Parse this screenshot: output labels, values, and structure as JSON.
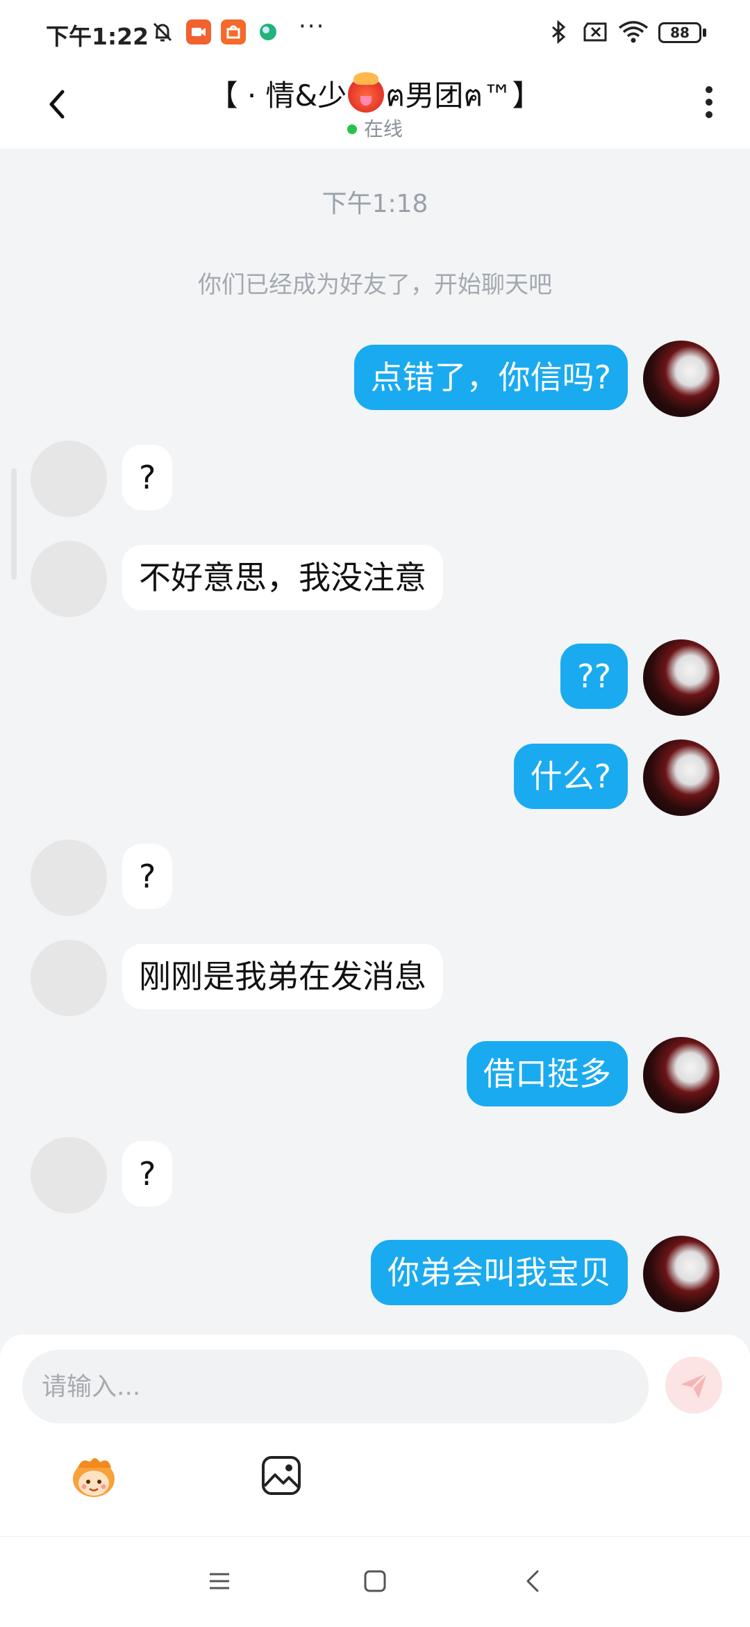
{
  "status_bar": {
    "time": "下午1:22",
    "dots": "···",
    "battery": "88",
    "icons": [
      "mute-bell-icon",
      "video-app-icon",
      "shop-app-icon",
      "globe-app-icon",
      "bluetooth-icon",
      "no-sim-icon",
      "wifi-icon",
      "battery-icon"
    ]
  },
  "header": {
    "title_before": "【 · 情&少",
    "title_after": "ฅ男团ฅ™】",
    "status": "在线",
    "status_color": "#2bc24a"
  },
  "chat": {
    "time_separator": "下午1:18",
    "system_message": "你们已经成为好友了，开始聊天吧",
    "messages": [
      {
        "from": "me",
        "text": "点错了，你信吗?"
      },
      {
        "from": "other",
        "text": "?"
      },
      {
        "from": "other",
        "text": "不好意思，我没注意"
      },
      {
        "from": "me",
        "text": "??"
      },
      {
        "from": "me",
        "text": "什么?"
      },
      {
        "from": "other",
        "text": "?"
      },
      {
        "from": "other",
        "text": "刚刚是我弟在发消息"
      },
      {
        "from": "me",
        "text": "借口挺多"
      },
      {
        "from": "other",
        "text": "?"
      },
      {
        "from": "me",
        "text": "你弟会叫我宝贝"
      }
    ]
  },
  "input": {
    "placeholder": "请输入...",
    "value": ""
  },
  "colors": {
    "my_bubble": "#1aaaf0",
    "other_bubble": "#ffffff",
    "background": "#f2f4f6",
    "send_button": "#fde4e4"
  }
}
